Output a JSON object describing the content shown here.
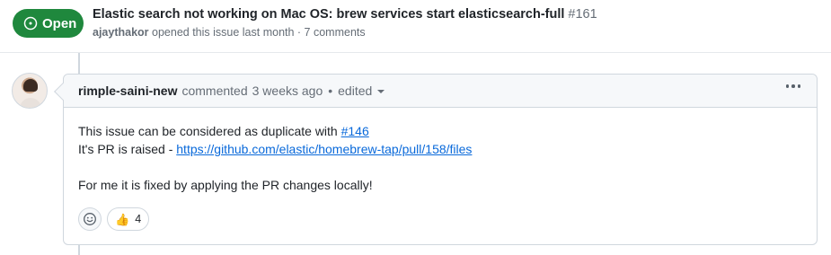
{
  "issue": {
    "state_label": "Open",
    "title": "Elastic search not working on Mac OS: brew services start elasticsearch-full",
    "number": "#161",
    "author": "ajaythakor",
    "meta_text": "opened this issue last month · 7 comments"
  },
  "comment": {
    "author": "rimple-saini-new",
    "action": "commented",
    "time": "3 weeks ago",
    "separator": "•",
    "edited_label": "edited",
    "body": {
      "line1_text": "This issue can be considered as duplicate with ",
      "line1_link": "#146",
      "line2_text": "It's PR is raised - ",
      "line2_link": "https://github.com/elastic/homebrew-tap/pull/158/files",
      "line3_text": "For me it is fixed by applying the PR changes locally!"
    },
    "reactions": [
      {
        "emoji": "👍",
        "count": "4"
      }
    ]
  },
  "colors": {
    "open_green": "#1f883d",
    "link_blue": "#0969da",
    "border": "#d0d7de",
    "header_bg": "#f6f8fa"
  },
  "icons": {
    "state": "issue-opened-icon",
    "more": "kebab-horizontal-icon",
    "emoji_picker": "smiley-icon"
  }
}
